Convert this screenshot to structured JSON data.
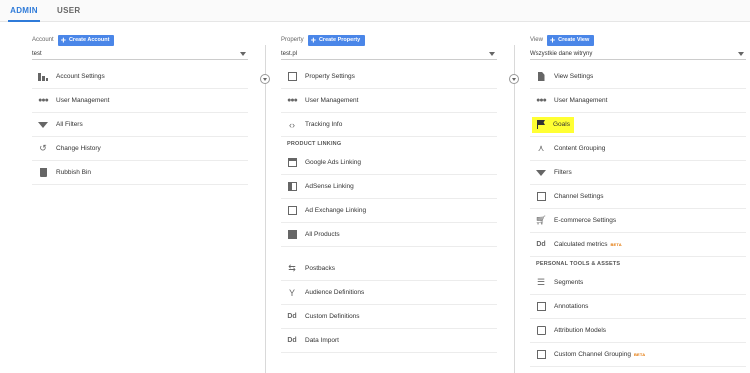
{
  "tabs": {
    "admin": "ADMIN",
    "user": "USER"
  },
  "account": {
    "label": "Account",
    "create": "Create Account",
    "selected": "test",
    "items": [
      {
        "label": "Account Settings"
      },
      {
        "label": "User Management"
      },
      {
        "label": "All Filters"
      },
      {
        "label": "Change History"
      },
      {
        "label": "Rubbish Bin"
      }
    ]
  },
  "property": {
    "label": "Property",
    "create": "Create Property",
    "selected": "test.pl",
    "items": [
      {
        "label": "Property Settings"
      },
      {
        "label": "User Management"
      },
      {
        "label": "Tracking Info"
      }
    ],
    "section": "PRODUCT LINKING",
    "linking": [
      {
        "label": "Google Ads Linking"
      },
      {
        "label": "AdSense Linking"
      },
      {
        "label": "Ad Exchange Linking"
      },
      {
        "label": "All Products"
      }
    ],
    "more": [
      {
        "label": "Postbacks"
      },
      {
        "label": "Audience Definitions"
      },
      {
        "label": "Custom Definitions"
      },
      {
        "label": "Data Import"
      }
    ]
  },
  "view": {
    "label": "View",
    "create": "Create View",
    "selected": "Wszystkie dane witryny",
    "items": [
      {
        "label": "View Settings"
      },
      {
        "label": "User Management"
      },
      {
        "label": "Goals"
      },
      {
        "label": "Content Grouping"
      },
      {
        "label": "Filters"
      },
      {
        "label": "Channel Settings"
      },
      {
        "label": "E-commerce Settings"
      },
      {
        "label": "Calculated metrics",
        "badge": "BETA"
      }
    ],
    "section": "PERSONAL TOOLS & ASSETS",
    "tools": [
      {
        "label": "Segments"
      },
      {
        "label": "Annotations"
      },
      {
        "label": "Attribution Models"
      },
      {
        "label": "Custom Channel Grouping",
        "badge": "BETA"
      }
    ]
  },
  "colors": {
    "accent": "#4a86e8",
    "tab_active": "#2f7bd9",
    "highlight": "#ffff33",
    "beta": "#e37400"
  }
}
